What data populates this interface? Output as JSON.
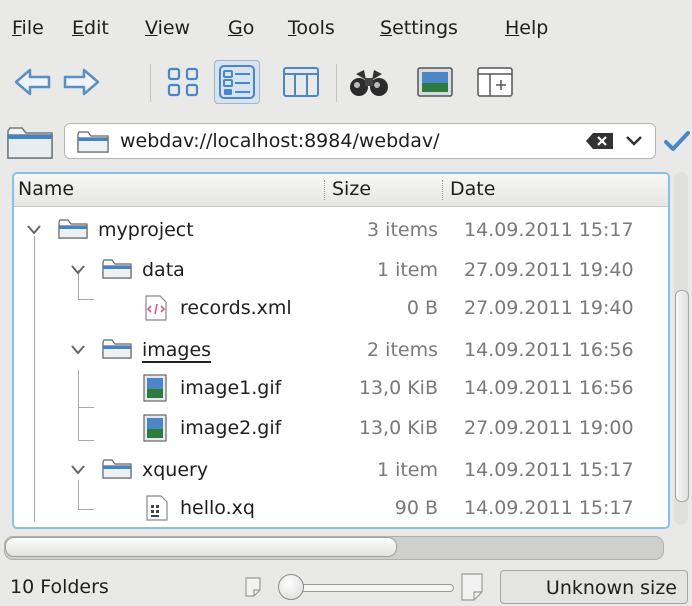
{
  "menu": {
    "items": [
      {
        "label_ul": "F",
        "label_rest": "ile"
      },
      {
        "label_ul": "E",
        "label_rest": "dit"
      },
      {
        "label_ul": "V",
        "label_rest": "iew"
      },
      {
        "label_ul": "G",
        "label_rest": "o"
      },
      {
        "label_ul": "T",
        "label_rest": "ools"
      },
      {
        "label_ul": "S",
        "label_rest": "ettings"
      },
      {
        "label_ul": "H",
        "label_rest": "elp"
      }
    ]
  },
  "toolbar": {
    "icons": [
      "back-arrow-icon",
      "forward-arrow-icon",
      "icons-view-icon",
      "details-view-icon",
      "columns-view-icon",
      "find-binoculars-icon",
      "preview-icon",
      "split-view-icon"
    ],
    "active_view": "details"
  },
  "location": {
    "url": "webdav://localhost:8984/webdav/"
  },
  "columns": {
    "name": "Name",
    "size": "Size",
    "date": "Date"
  },
  "rows": [
    {
      "name": "myproject",
      "size": "3 items",
      "date": "14.09.2011 15:17",
      "type": "folder",
      "level": 0,
      "expanded": true
    },
    {
      "name": "data",
      "size": "1 item",
      "date": "27.09.2011 19:40",
      "type": "folder",
      "level": 1,
      "expanded": true
    },
    {
      "name": "records.xml",
      "size": "0 B",
      "date": "27.09.2011 19:40",
      "type": "xml",
      "level": 2
    },
    {
      "name": "images",
      "size": "2 items",
      "date": "14.09.2011 16:56",
      "type": "folder",
      "level": 1,
      "expanded": true
    },
    {
      "name": "image1.gif",
      "size": "13,0 KiB",
      "date": "14.09.2011 16:56",
      "type": "image",
      "level": 2
    },
    {
      "name": "image2.gif",
      "size": "13,0 KiB",
      "date": "27.09.2011 19:00",
      "type": "image",
      "level": 2
    },
    {
      "name": "xquery",
      "size": "1 item",
      "date": "14.09.2011 15:17",
      "type": "folder",
      "level": 1,
      "expanded": true
    },
    {
      "name": "hello.xq",
      "size": "90 B",
      "date": "14.09.2011 15:17",
      "type": "script",
      "level": 2
    }
  ],
  "status": {
    "summary": "10 Folders",
    "space": "Unknown size"
  },
  "colors": {
    "focus_border": "#8bbfe6",
    "folder_blue": "#3f86c9",
    "check_blue": "#4a86c8"
  }
}
